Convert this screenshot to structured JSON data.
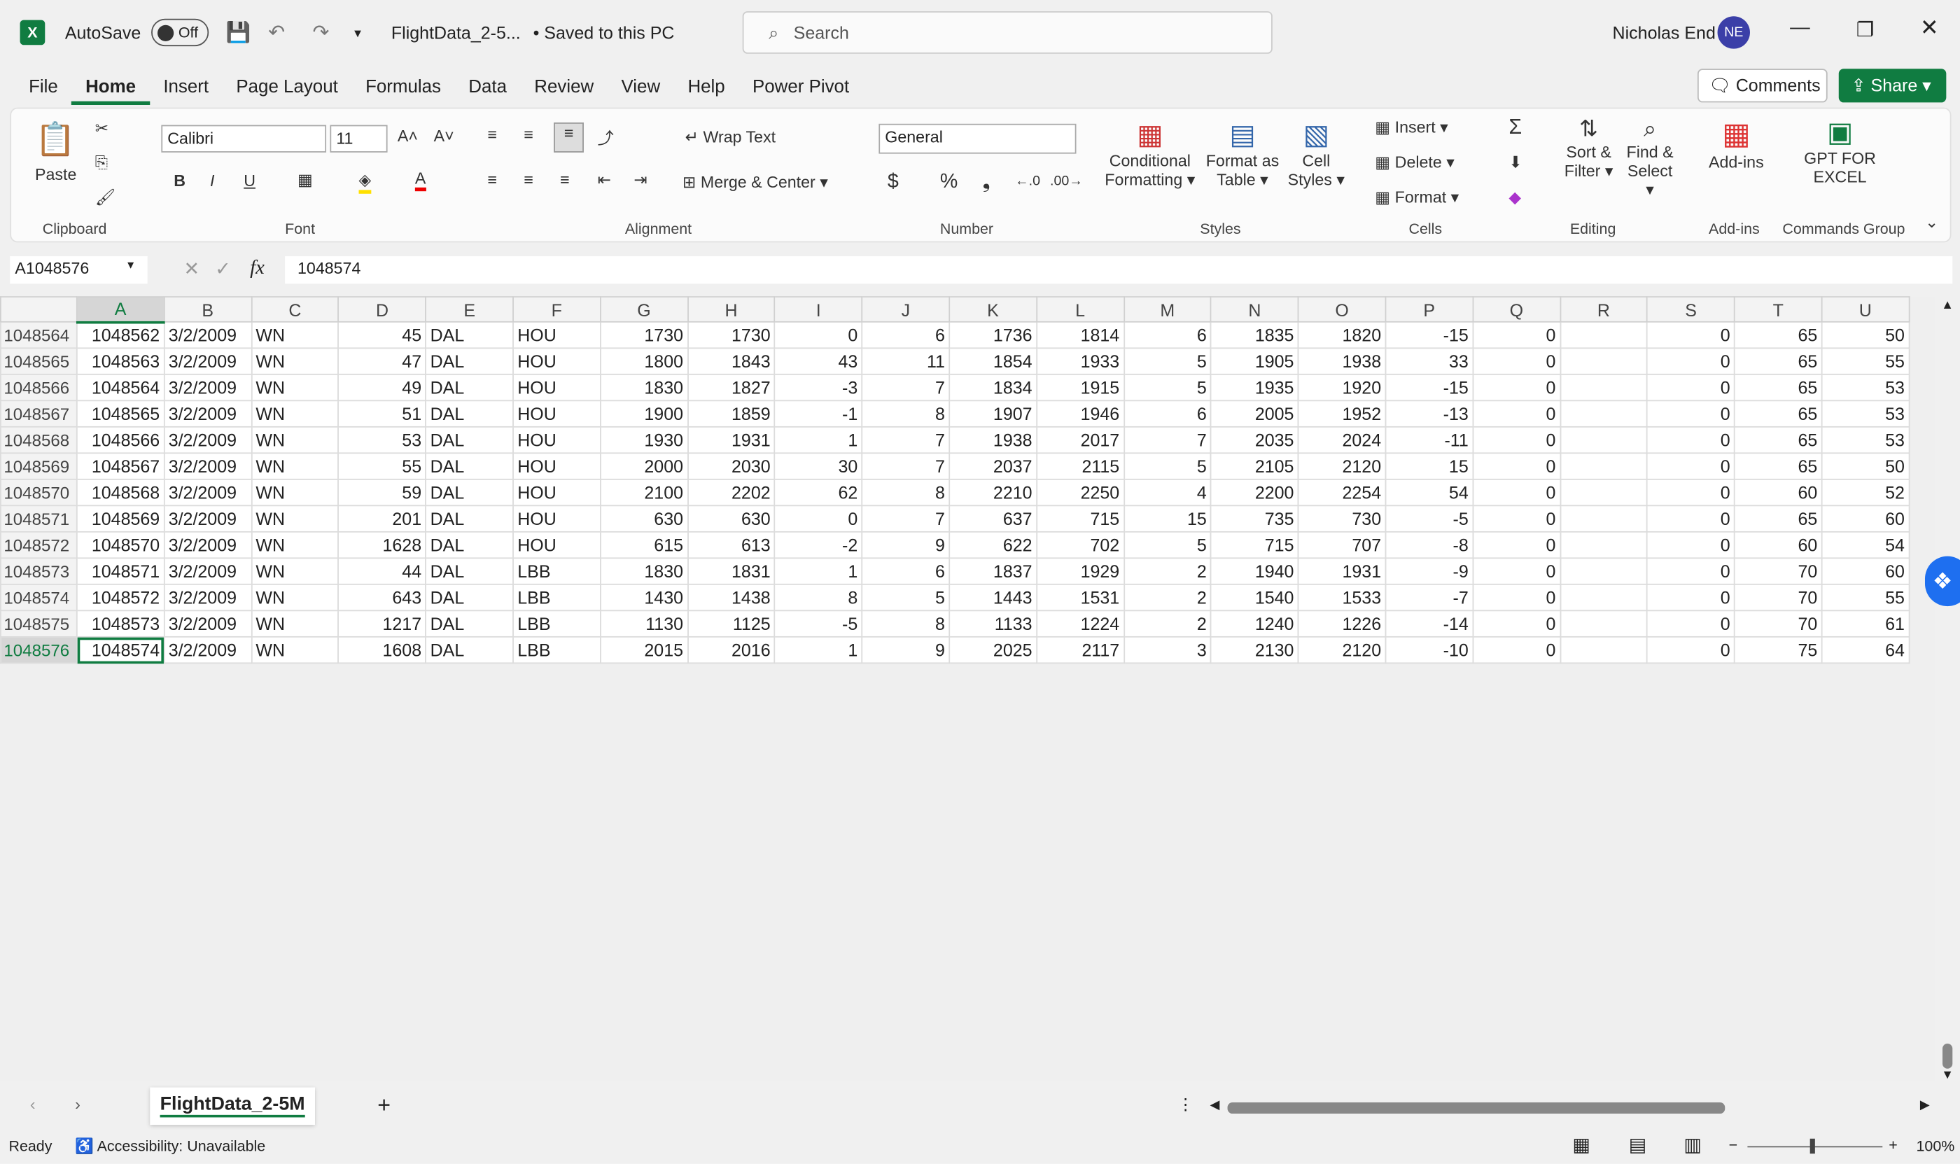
{
  "titlebar": {
    "autosave": "AutoSave",
    "autosave_state": "Off",
    "filename": "FlightData_2-5...",
    "saved": "• Saved to this PC",
    "search_placeholder": "Search",
    "user": "Nicholas End",
    "initials": "NE"
  },
  "menu": [
    "File",
    "Home",
    "Insert",
    "Page Layout",
    "Formulas",
    "Data",
    "Review",
    "View",
    "Help",
    "Power Pivot"
  ],
  "buttons": {
    "comments": "Comments",
    "share": "Share"
  },
  "ribbon": {
    "paste": "Paste",
    "clipboard": "Clipboard",
    "font_name": "Calibri",
    "font_size": "11",
    "font": "Font",
    "wrap_text": "Wrap Text",
    "merge_center": "Merge & Center",
    "alignment": "Alignment",
    "number_format": "General",
    "number": "Number",
    "conditional": "Conditional",
    "formatting": "Formatting",
    "format_as": "Format as",
    "table": "Table",
    "cell": "Cell",
    "styles_btn": "Styles",
    "styles": "Styles",
    "insert": "Insert",
    "delete": "Delete",
    "format": "Format",
    "cells": "Cells",
    "sort": "Sort &",
    "filter": "Filter",
    "find": "Find &",
    "select": "Select",
    "editing": "Editing",
    "addins_btn": "Add-ins",
    "addins": "Add-ins",
    "gpt1": "GPT FOR",
    "gpt2": "EXCEL",
    "commands": "Commands Group",
    "bold": "B",
    "italic": "I",
    "underline": "U"
  },
  "formula_bar": {
    "name_box": "A1048576",
    "fx": "fx",
    "value": "1048574"
  },
  "columns": [
    "A",
    "B",
    "C",
    "D",
    "E",
    "F",
    "G",
    "H",
    "I",
    "J",
    "K",
    "L",
    "M",
    "N",
    "O",
    "P",
    "Q",
    "R",
    "S",
    "T",
    "U"
  ],
  "rows": [
    [
      "1048564",
      "1048562",
      "3/2/2009",
      "WN",
      "45",
      "DAL",
      "HOU",
      "1730",
      "1730",
      "0",
      "6",
      "1736",
      "1814",
      "6",
      "1835",
      "1820",
      "-15",
      "0",
      "",
      "0",
      "65",
      "50"
    ],
    [
      "1048565",
      "1048563",
      "3/2/2009",
      "WN",
      "47",
      "DAL",
      "HOU",
      "1800",
      "1843",
      "43",
      "11",
      "1854",
      "1933",
      "5",
      "1905",
      "1938",
      "33",
      "0",
      "",
      "0",
      "65",
      "55"
    ],
    [
      "1048566",
      "1048564",
      "3/2/2009",
      "WN",
      "49",
      "DAL",
      "HOU",
      "1830",
      "1827",
      "-3",
      "7",
      "1834",
      "1915",
      "5",
      "1935",
      "1920",
      "-15",
      "0",
      "",
      "0",
      "65",
      "53"
    ],
    [
      "1048567",
      "1048565",
      "3/2/2009",
      "WN",
      "51",
      "DAL",
      "HOU",
      "1900",
      "1859",
      "-1",
      "8",
      "1907",
      "1946",
      "6",
      "2005",
      "1952",
      "-13",
      "0",
      "",
      "0",
      "65",
      "53"
    ],
    [
      "1048568",
      "1048566",
      "3/2/2009",
      "WN",
      "53",
      "DAL",
      "HOU",
      "1930",
      "1931",
      "1",
      "7",
      "1938",
      "2017",
      "7",
      "2035",
      "2024",
      "-11",
      "0",
      "",
      "0",
      "65",
      "53"
    ],
    [
      "1048569",
      "1048567",
      "3/2/2009",
      "WN",
      "55",
      "DAL",
      "HOU",
      "2000",
      "2030",
      "30",
      "7",
      "2037",
      "2115",
      "5",
      "2105",
      "2120",
      "15",
      "0",
      "",
      "0",
      "65",
      "50"
    ],
    [
      "1048570",
      "1048568",
      "3/2/2009",
      "WN",
      "59",
      "DAL",
      "HOU",
      "2100",
      "2202",
      "62",
      "8",
      "2210",
      "2250",
      "4",
      "2200",
      "2254",
      "54",
      "0",
      "",
      "0",
      "60",
      "52"
    ],
    [
      "1048571",
      "1048569",
      "3/2/2009",
      "WN",
      "201",
      "DAL",
      "HOU",
      "630",
      "630",
      "0",
      "7",
      "637",
      "715",
      "15",
      "735",
      "730",
      "-5",
      "0",
      "",
      "0",
      "65",
      "60"
    ],
    [
      "1048572",
      "1048570",
      "3/2/2009",
      "WN",
      "1628",
      "DAL",
      "HOU",
      "615",
      "613",
      "-2",
      "9",
      "622",
      "702",
      "5",
      "715",
      "707",
      "-8",
      "0",
      "",
      "0",
      "60",
      "54"
    ],
    [
      "1048573",
      "1048571",
      "3/2/2009",
      "WN",
      "44",
      "DAL",
      "LBB",
      "1830",
      "1831",
      "1",
      "6",
      "1837",
      "1929",
      "2",
      "1940",
      "1931",
      "-9",
      "0",
      "",
      "0",
      "70",
      "60"
    ],
    [
      "1048574",
      "1048572",
      "3/2/2009",
      "WN",
      "643",
      "DAL",
      "LBB",
      "1430",
      "1438",
      "8",
      "5",
      "1443",
      "1531",
      "2",
      "1540",
      "1533",
      "-7",
      "0",
      "",
      "0",
      "70",
      "55"
    ],
    [
      "1048575",
      "1048573",
      "3/2/2009",
      "WN",
      "1217",
      "DAL",
      "LBB",
      "1130",
      "1125",
      "-5",
      "8",
      "1133",
      "1224",
      "2",
      "1240",
      "1226",
      "-14",
      "0",
      "",
      "0",
      "70",
      "61"
    ],
    [
      "1048576",
      "1048574",
      "3/2/2009",
      "WN",
      "1608",
      "DAL",
      "LBB",
      "2015",
      "2016",
      "1",
      "9",
      "2025",
      "2117",
      "3",
      "2130",
      "2120",
      "-10",
      "0",
      "",
      "0",
      "75",
      "64"
    ]
  ],
  "sheet_tab": "FlightData_2-5M",
  "status": {
    "ready": "Ready",
    "accessibility": "Accessibility: Unavailable",
    "zoom": "100%"
  },
  "colors": {
    "accent": "#107c41"
  }
}
